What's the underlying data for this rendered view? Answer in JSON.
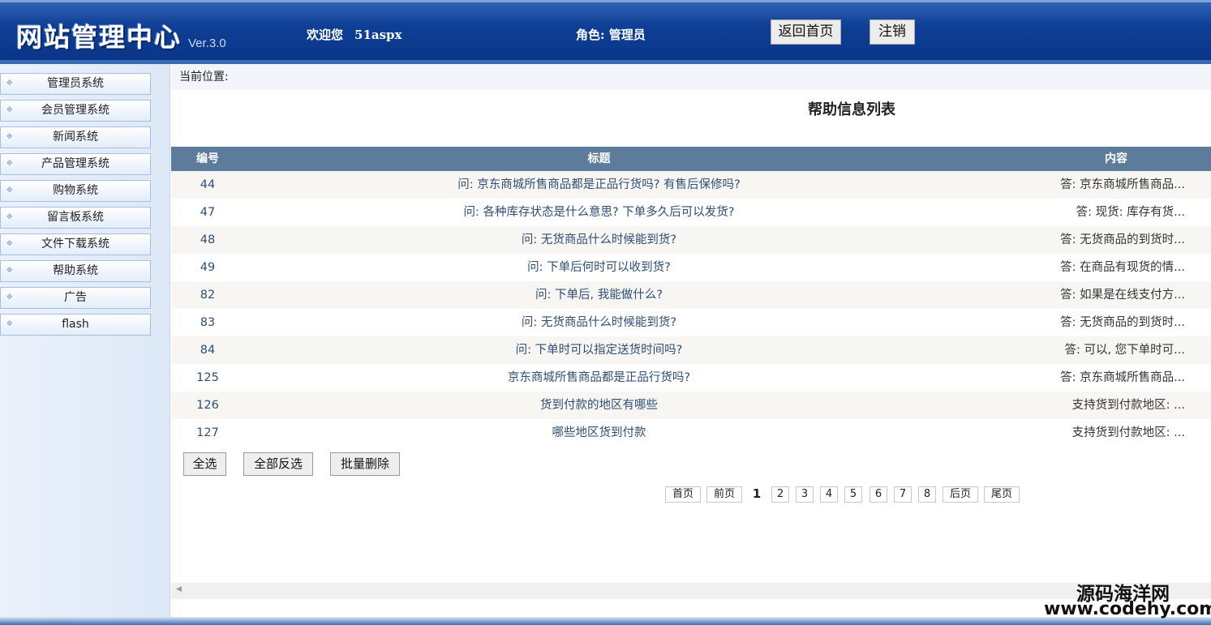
{
  "header": {
    "logo_text": "网站管理中心",
    "version": "Ver.3.0",
    "welcome_label": "欢迎您",
    "username": "51aspx",
    "role": "角色: 管理员",
    "home_button": "返回首页",
    "logout_button": "注销"
  },
  "sidebar": {
    "items": [
      {
        "label": "管理员系统"
      },
      {
        "label": "会员管理系统"
      },
      {
        "label": "新闻系统"
      },
      {
        "label": "产品管理系统"
      },
      {
        "label": "购物系统"
      },
      {
        "label": "留言板系统"
      },
      {
        "label": "文件下载系统"
      },
      {
        "label": "帮助系统"
      },
      {
        "label": "广告"
      },
      {
        "label": "flash"
      }
    ]
  },
  "main": {
    "location": "当前位置:",
    "title": "帮助信息列表",
    "columns": {
      "id": "编号",
      "title": "标题",
      "content": "内容"
    },
    "rows": [
      {
        "id": "44",
        "title": "问: 京东商城所售商品都是正品行货吗? 有售后保修吗?",
        "content": "答: 京东商城所售商品..."
      },
      {
        "id": "47",
        "title": "问: 各种库存状态是什么意思? 下单多久后可以发货?",
        "content": "答: 现货:  库存有货..."
      },
      {
        "id": "48",
        "title": "问: 无货商品什么时候能到货?",
        "content": "答: 无货商品的到货时..."
      },
      {
        "id": "49",
        "title": "问: 下单后何时可以收到货?",
        "content": "答: 在商品有现货的情..."
      },
      {
        "id": "82",
        "title": "问: 下单后, 我能做什么?",
        "content": "答: 如果是在线支付方..."
      },
      {
        "id": "83",
        "title": "问: 无货商品什么时候能到货?",
        "content": "答: 无货商品的到货时..."
      },
      {
        "id": "84",
        "title": "问: 下单时可以指定送货时间吗?",
        "content": "答: 可以, 您下单时可..."
      },
      {
        "id": "125",
        "title": "京东商城所售商品都是正品行货吗?",
        "content": "答: 京东商城所售商品..."
      },
      {
        "id": "126",
        "title": "货到付款的地区有哪些",
        "content": "支持货到付款地区:  ..."
      },
      {
        "id": "127",
        "title": "哪些地区货到付款",
        "content": "支持货到付款地区:  ..."
      }
    ],
    "actions": {
      "select_all": "全选",
      "invert": "全部反选",
      "batch_delete": "批量删除"
    },
    "pager": {
      "first": "首页",
      "prev": "前页",
      "current": "1",
      "pages": [
        "2",
        "3",
        "4",
        "5",
        "6",
        "7",
        "8"
      ],
      "next": "后页",
      "last": "尾页"
    }
  },
  "watermark": {
    "line1": "源码海洋网",
    "line2": "www.codehy.com"
  }
}
